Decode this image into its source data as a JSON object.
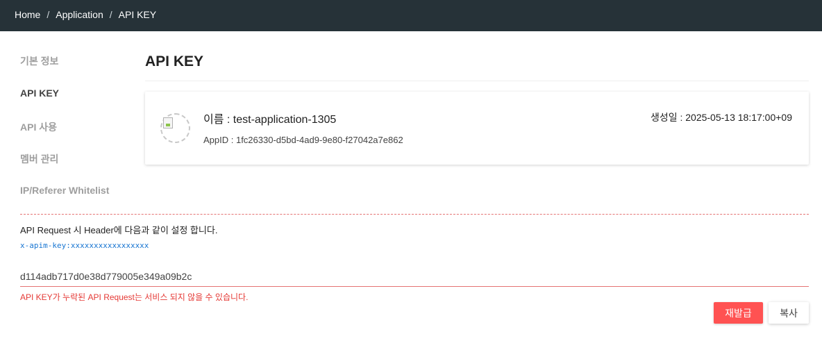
{
  "breadcrumb": {
    "items": [
      "Home",
      "Application",
      "API KEY"
    ],
    "separator": "/"
  },
  "sidebar": {
    "items": [
      {
        "label": "기본 정보",
        "active": false
      },
      {
        "label": "API KEY",
        "active": true
      },
      {
        "label": "API 사용",
        "active": false
      },
      {
        "label": "멤버 관리",
        "active": false
      },
      {
        "label": "IP/Referer Whitelist",
        "active": false
      }
    ]
  },
  "main": {
    "title": "API KEY",
    "card": {
      "name": "이름 : test-application-1305",
      "app_id": "AppID : 1fc26330-d5bd-4ad9-9e80-f27042a7e862",
      "created": "생성일 : 2025-05-13 18:17:00+09"
    },
    "hint": "API Request 시 Header에 다음과 같이 설정 합니다.",
    "header_example": "x-apim-key:xxxxxxxxxxxxxxxxx",
    "api_key_value": "d114adb717d0e38d779005e349a09b2c",
    "api_key_error": "API KEY가 누락된 API Request는 서비스 되지 않을 수 있습니다.",
    "buttons": {
      "reissue": "재발급",
      "copy": "복사"
    }
  },
  "colors": {
    "topbar": "#263238",
    "accent_red": "#ff5252",
    "error_red": "#e53935",
    "code_blue": "#1976d2"
  }
}
